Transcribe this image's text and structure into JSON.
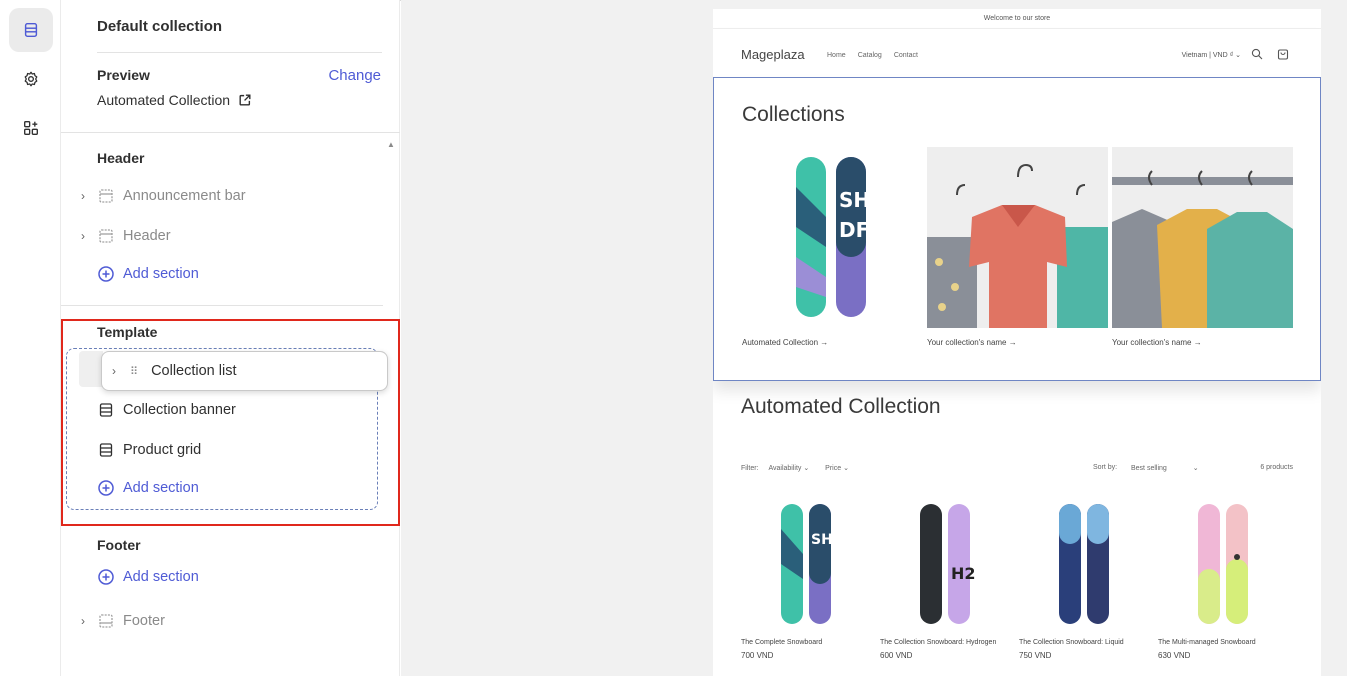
{
  "rail": {
    "items": [
      {
        "icon": "sections-icon",
        "active": true
      },
      {
        "icon": "gear-icon",
        "active": false
      },
      {
        "icon": "apps-add-icon",
        "active": false
      }
    ]
  },
  "sidebar": {
    "title": "Default collection",
    "preview": {
      "label": "Preview",
      "change_label": "Change",
      "value": "Automated Collection"
    },
    "header_group": {
      "title": "Header",
      "items": [
        {
          "label": "Announcement bar"
        },
        {
          "label": "Header"
        }
      ],
      "add_label": "Add section"
    },
    "template_group": {
      "title": "Template",
      "dragging_item": "Collection list",
      "items": [
        {
          "label": "Collection banner"
        },
        {
          "label": "Product grid"
        }
      ],
      "add_label": "Add section"
    },
    "footer_group": {
      "title": "Footer",
      "add_label": "Add section",
      "items": [
        {
          "label": "Footer"
        }
      ]
    }
  },
  "store": {
    "announcement": "Welcome to our store",
    "brand": "Mageplaza",
    "nav": [
      "Home",
      "Catalog",
      "Contact"
    ],
    "locale": "Vietnam | VND ₫",
    "collections": {
      "title": "Collections",
      "cards": [
        {
          "label": "Automated Collection →"
        },
        {
          "label": "Your collection's name →"
        },
        {
          "label": "Your collection's name →"
        }
      ]
    },
    "collection_page": {
      "title": "Automated Collection",
      "filter_label": "Filter:",
      "filters": [
        "Availability",
        "Price"
      ],
      "sort_label": "Sort by:",
      "sort_value": "Best selling",
      "count": "6 products",
      "products": [
        {
          "name": "The Complete Snowboard",
          "price": "700 VND"
        },
        {
          "name": "The Collection Snowboard: Hydrogen",
          "price": "600 VND"
        },
        {
          "name": "The Collection Snowboard: Liquid",
          "price": "750 VND"
        },
        {
          "name": "The Multi-managed Snowboard",
          "price": "630 VND"
        }
      ]
    }
  }
}
